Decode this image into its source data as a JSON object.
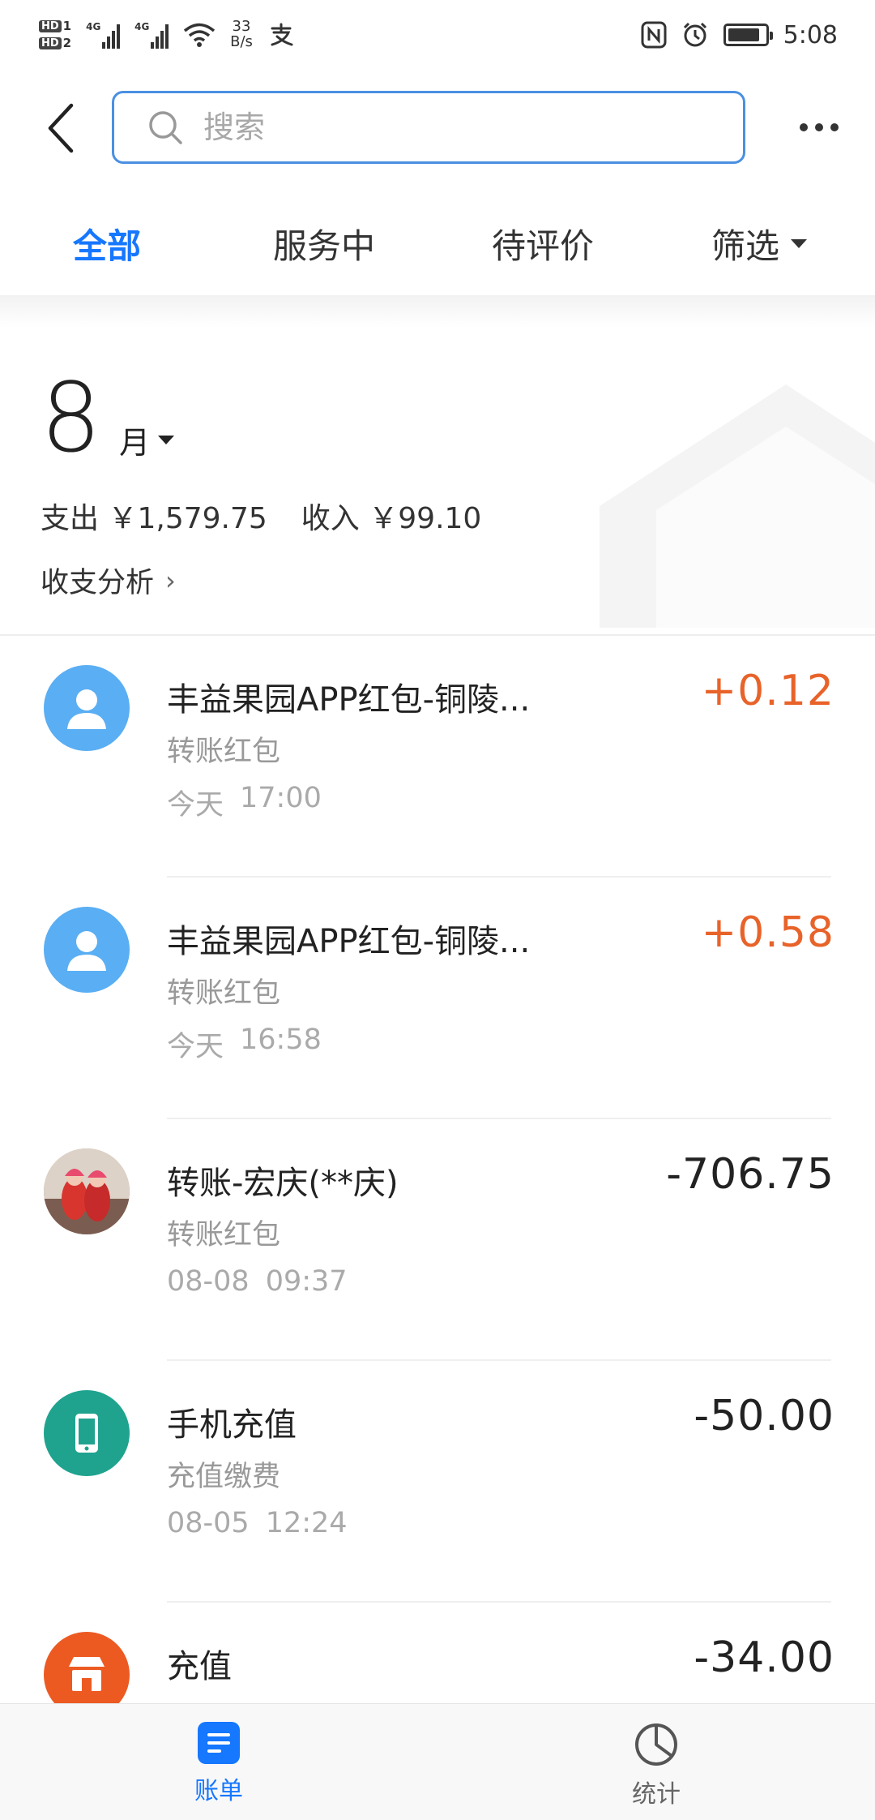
{
  "status_bar": {
    "hd1": "HD",
    "hd1_sub": "1",
    "hd2": "HD",
    "hd2_sub": "2",
    "net1": "4G",
    "net2": "4G",
    "speed_value": "33",
    "speed_unit": "B/s",
    "time": "5:08"
  },
  "header": {
    "search_placeholder": "搜索"
  },
  "tabs": [
    {
      "label": "全部",
      "active": true
    },
    {
      "label": "服务中",
      "active": false
    },
    {
      "label": "待评价",
      "active": false
    },
    {
      "label": "筛选",
      "active": false
    }
  ],
  "summary": {
    "month": "8",
    "month_unit": "月",
    "expense_label": "支出",
    "expense_value": "￥1,579.75",
    "income_label": "收入",
    "income_value": "￥99.10",
    "analysis_label": "收支分析",
    "analysis_chevron": "›"
  },
  "transactions": [
    {
      "title": "丰益果园APP红包-铜陵...",
      "category": "转账红包",
      "date": "今天",
      "time": "17:00",
      "amount": "+0.12",
      "avatar": "person-icon"
    },
    {
      "title": "丰益果园APP红包-铜陵...",
      "category": "转账红包",
      "date": "今天",
      "time": "16:58",
      "amount": "+0.58",
      "avatar": "person-icon"
    },
    {
      "title": "转账-宏庆(**庆)",
      "category": "转账红包",
      "date": "08-08",
      "time": "09:37",
      "amount": "-706.75",
      "avatar": "photo"
    },
    {
      "title": "手机充值",
      "category": "充值缴费",
      "date": "08-05",
      "time": "12:24",
      "amount": "-50.00",
      "avatar": "phone-icon"
    },
    {
      "title": "充值",
      "category": "",
      "date": "",
      "time": "",
      "amount": "-34.00",
      "avatar": "shop-icon"
    }
  ],
  "bottom_nav": [
    {
      "label": "账单",
      "active": true,
      "icon": "bill-icon"
    },
    {
      "label": "统计",
      "active": false,
      "icon": "pie-chart-icon"
    }
  ],
  "colors": {
    "accent": "#1677ff",
    "income": "#e8632a",
    "search_border": "#4a90e2"
  }
}
